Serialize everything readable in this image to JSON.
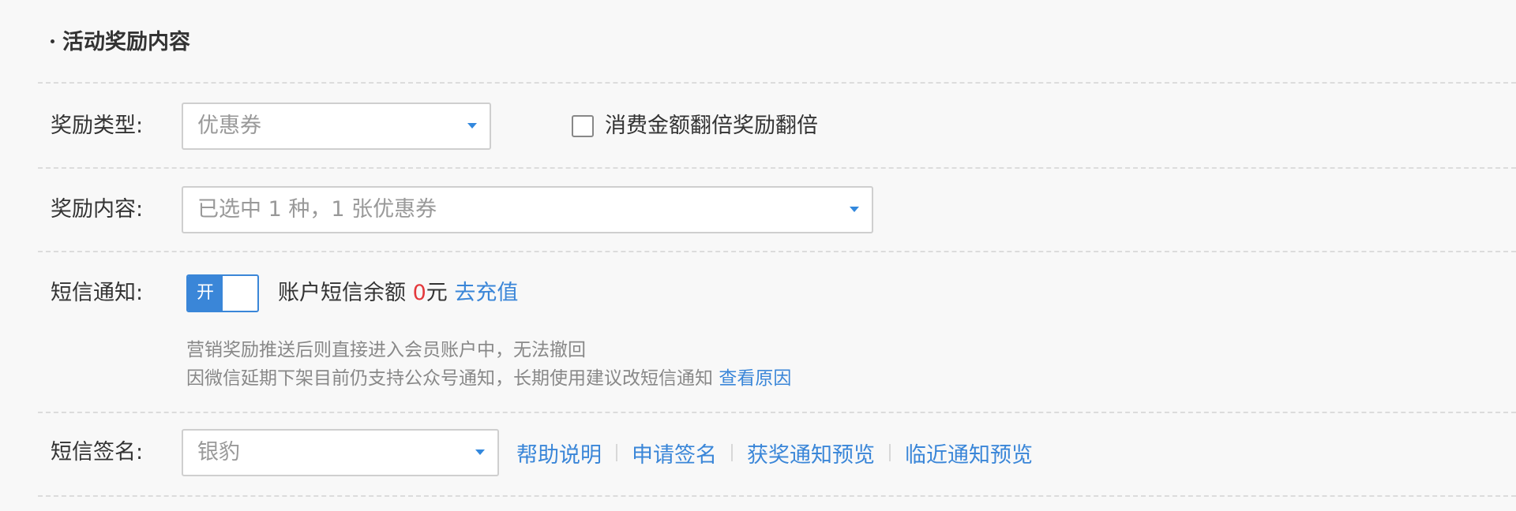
{
  "section": {
    "title": "活动奖励内容"
  },
  "reward_type": {
    "label": "奖励类型:",
    "selected": "优惠券",
    "double_checkbox_label": "消费金额翻倍奖励翻倍",
    "double_checked": false
  },
  "reward_content": {
    "label": "奖励内容:",
    "selected": "已选中 1 种，1 张优惠券"
  },
  "sms_notify": {
    "label": "短信通知:",
    "toggle_label": "开",
    "toggle_on": true,
    "balance_prefix": "账户短信余额 ",
    "balance_amount": "0",
    "balance_unit": "元",
    "recharge_link": "去充值",
    "hint_line1": "营销奖励推送后则直接进入会员账户中，无法撤回",
    "hint_line2": "因微信延期下架目前仍支持公众号通知，长期使用建议改短信通知 ",
    "reason_link": "查看原因"
  },
  "sms_signature": {
    "label": "短信签名:",
    "selected": "银豹",
    "links": [
      "帮助说明",
      "申请签名",
      "获奖通知预览",
      "临近通知预览"
    ]
  },
  "colors": {
    "accent": "#3a86d8",
    "danger": "#e4393c"
  }
}
